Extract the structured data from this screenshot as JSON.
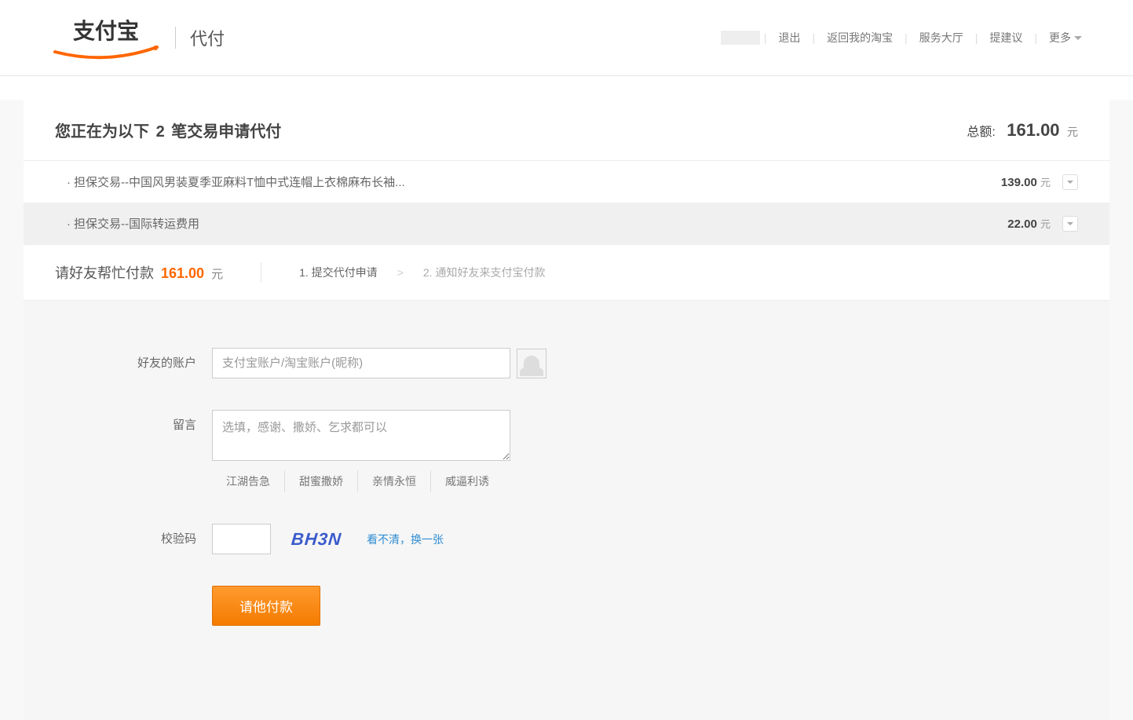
{
  "header": {
    "logo_text": "支付宝",
    "section": "代付",
    "nav": {
      "logout": "退出",
      "back_taobao": "返回我的淘宝",
      "service": "服务大厅",
      "suggest": "提建议",
      "more": "更多"
    }
  },
  "summary": {
    "title_prefix": "您正在为以下",
    "count": "2",
    "title_suffix": "笔交易申请代付",
    "total_label": "总额:",
    "total_amount": "161.00",
    "unit": "元"
  },
  "transactions": [
    {
      "name": "担保交易--中国风男装夏季亚麻料T恤中式连帽上衣棉麻布长袖...",
      "amount": "139.00",
      "unit": "元"
    },
    {
      "name": "担保交易--国际转运费用",
      "amount": "22.00",
      "unit": "元"
    }
  ],
  "step_bar": {
    "lead": "请好友帮忙付款",
    "amount": "161.00",
    "unit": "元",
    "step1": "1. 提交代付申请",
    "arrow": ">",
    "step2": "2. 通知好友来支付宝付款"
  },
  "form": {
    "account_label": "好友的账户",
    "account_placeholder": "支付宝账户/淘宝账户(昵称)",
    "message_label": "留言",
    "message_placeholder": "选填，感谢、撒娇、乞求都可以",
    "templates": [
      "江湖告急",
      "甜蜜撒娇",
      "亲情永恒",
      "威逼利诱"
    ],
    "captcha_label": "校验码",
    "captcha_text": "BH3N",
    "captcha_refresh": "看不清，换一张",
    "submit": "请他付款"
  }
}
